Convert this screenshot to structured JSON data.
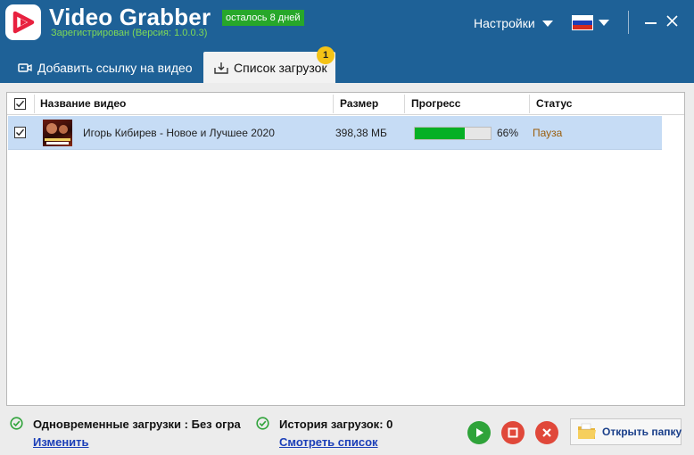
{
  "app": {
    "title": "Video Grabber",
    "trial_badge": "осталось 8 дней",
    "subtitle": "Зарегистрирован (Версия: 1.0.0.3)",
    "settings_label": "Настройки",
    "language": "ru"
  },
  "tabs": [
    {
      "label": "Добавить ссылку на видео",
      "active": false
    },
    {
      "label": "Список загрузок",
      "active": true,
      "badge": "1"
    }
  ],
  "table": {
    "columns": [
      "Название видео",
      "Размер",
      "Прогресс",
      "Статус"
    ],
    "rows": [
      {
        "checked": true,
        "title": "Игорь Кибирев  -  Новое и Лучшее 2020",
        "size": "398,38 МБ",
        "progress": 0.66,
        "progress_label": "66%",
        "status": "Пауза"
      }
    ]
  },
  "footer": {
    "concurrent_label": "Одновременные загрузки : Без огра",
    "concurrent_link": "Изменить",
    "history_label": "История загрузок: 0",
    "history_link": "Смотреть список",
    "open_folder_label": "Открыть папку"
  },
  "colors": {
    "titlebar": "#1e6197",
    "trial_badge": "#27a72a",
    "subtitle": "#7ed957",
    "progress_fill": "#06b025",
    "row_selected": "#c6dcf5",
    "status_paused": "#9a5d0c",
    "badge": "#f4c316",
    "play": "#2fa33a",
    "stop": "#e0483a",
    "link": "#1c3fb8"
  },
  "icons": {
    "logo": "play-logo-icon",
    "settings_caret": "chevron-down-icon",
    "flag": "flag-ru-icon",
    "minimize": "minimize-icon",
    "close": "close-icon",
    "add_link_tab": "video-camera-icon",
    "downloads_tab": "download-tray-icon",
    "footer_check": "check-circle-icon",
    "play": "play-icon",
    "stop": "stop-icon",
    "delete": "delete-x-icon",
    "folder": "folder-icon"
  }
}
